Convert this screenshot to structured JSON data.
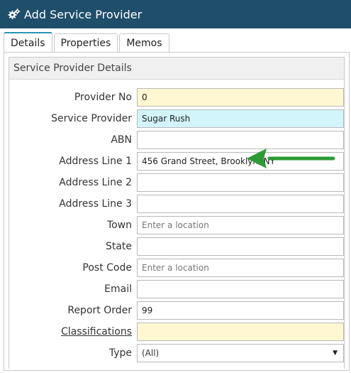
{
  "window": {
    "title": "Add Service Provider",
    "title_icon": "gears-icon"
  },
  "tabs": [
    {
      "label": "Details",
      "active": true
    },
    {
      "label": "Properties",
      "active": false
    },
    {
      "label": "Memos",
      "active": false
    }
  ],
  "section": {
    "title": "Service Provider Details"
  },
  "fields": [
    {
      "label": "Provider No",
      "value": "0",
      "placeholder": "",
      "style": "yellow"
    },
    {
      "label": "Service Provider",
      "value": "Sugar Rush",
      "placeholder": "",
      "style": "cyan"
    },
    {
      "label": "ABN",
      "value": "",
      "placeholder": ""
    },
    {
      "label": "Address Line 1",
      "value": "456 Grand Street, Brooklyn, NY",
      "placeholder": ""
    },
    {
      "label": "Address Line 2",
      "value": "",
      "placeholder": ""
    },
    {
      "label": "Address Line 3",
      "value": "",
      "placeholder": ""
    },
    {
      "label": "Town",
      "value": "",
      "placeholder": "Enter a location"
    },
    {
      "label": "State",
      "value": "",
      "placeholder": ""
    },
    {
      "label": "Post Code",
      "value": "",
      "placeholder": "Enter a location"
    },
    {
      "label": "Email",
      "value": "",
      "placeholder": ""
    },
    {
      "label": "Report Order",
      "value": "99",
      "placeholder": ""
    },
    {
      "label": "Classifications",
      "value": "",
      "placeholder": "",
      "style": "yellow",
      "link": true
    },
    {
      "label": "Type",
      "value": "(All)",
      "type": "select"
    }
  ],
  "annotation": {
    "icon": "arrow-left-icon",
    "color": "#2e9a35"
  }
}
